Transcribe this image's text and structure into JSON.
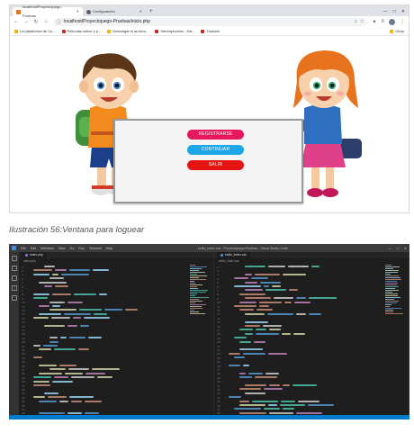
{
  "browser": {
    "tabs": [
      {
        "label": "localhost/Proyectojuego-Pruebas",
        "active": true,
        "favicon_color": "#e8711c"
      },
      {
        "label": "Configuración",
        "active": false,
        "favicon_color": "#5f6368"
      }
    ],
    "new_tab_symbol": "+",
    "window_controls": [
      "—",
      "□",
      "✕"
    ],
    "url": "localhost/Proyectojuego-Pruebas/inicio.php",
    "bookmarks": [
      {
        "label": "La plataforma de Cu...",
        "favicon_color": "#f4b400"
      },
      {
        "label": "Películas online y p...",
        "favicon_color": "#c62828"
      },
      {
        "label": "Descargar el archivo...",
        "favicon_color": "#f4b400"
      },
      {
        "label": "Stereophonics - Ma...",
        "favicon_color": "#c62828"
      },
      {
        "label": "Youtube",
        "favicon_color": "#c62828"
      }
    ],
    "bookmarks_right": "Otros",
    "page": {
      "buttons": {
        "register": "REGISTRARSE",
        "continue": "CONTINUAR",
        "exit": "SALIR"
      },
      "colors": {
        "register": "#e8185d",
        "continue": "#1da7e8",
        "exit": "#e61313"
      }
    }
  },
  "caption": "Ilustración 56:Ventana para loguear",
  "vscode": {
    "menu": [
      "File",
      "Edit",
      "Selection",
      "View",
      "Go",
      "Run",
      "Terminal",
      "Help"
    ],
    "window_title": "estilo_index.css - Proyectojuego-Pruebas - Visual Studio Code",
    "left_tab": "index.php",
    "right_tab": "estilo_index.css",
    "accent": "#007acc"
  }
}
